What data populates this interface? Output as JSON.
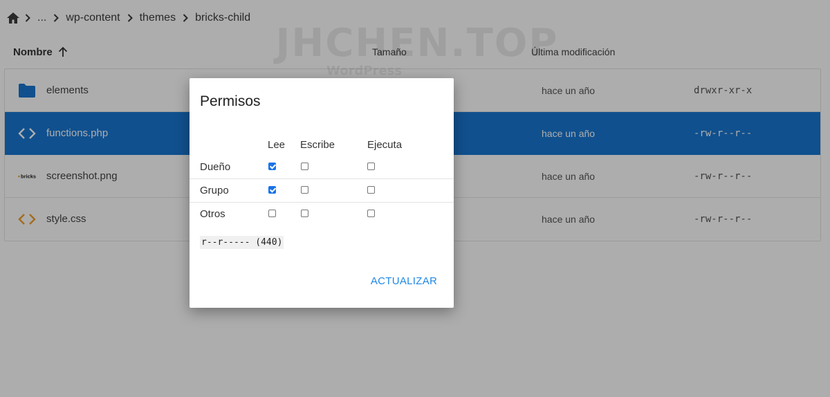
{
  "breadcrumb": {
    "items": [
      "...",
      "wp-content",
      "themes",
      "bricks-child"
    ]
  },
  "watermark": {
    "main": "JHCHEN.TOP",
    "sub": "WordPress"
  },
  "table": {
    "headers": {
      "name": "Nombre",
      "size": "Tamaño",
      "modified": "Última modificación"
    },
    "rows": [
      {
        "name": "elements",
        "modified": "hace un año",
        "permissions": "drwxr-xr-x",
        "icon": "folder-icon",
        "selected": false
      },
      {
        "name": "functions.php",
        "modified": "hace un año",
        "permissions": "-rw-r--r--",
        "icon": "code-icon",
        "selected": true
      },
      {
        "name": "screenshot.png",
        "modified": "hace un año",
        "permissions": "-rw-r--r--",
        "icon": "image-thumbnail-icon",
        "selected": false
      },
      {
        "name": "style.css",
        "modified": "hace un año",
        "permissions": "-rw-r--r--",
        "icon": "code-icon",
        "selected": false
      }
    ]
  },
  "dialog": {
    "title": "Permisos",
    "columns": [
      "Lee",
      "Escribe",
      "Ejecuta"
    ],
    "rows": [
      {
        "label": "Dueño",
        "read": true,
        "write": false,
        "execute": false
      },
      {
        "label": "Grupo",
        "read": true,
        "write": false,
        "execute": false
      },
      {
        "label": "Otros",
        "read": false,
        "write": false,
        "execute": false
      }
    ],
    "permission_string": "r--r----- (440)",
    "update_label": "ACTUALIZAR"
  },
  "thumbnail_text": "bricks",
  "colors": {
    "selected_row": "#1976d2",
    "accent": "#1e88e5",
    "folder": "#1976d2",
    "code_icon_selected": "#ffffff",
    "code_icon": "#f0a030"
  }
}
